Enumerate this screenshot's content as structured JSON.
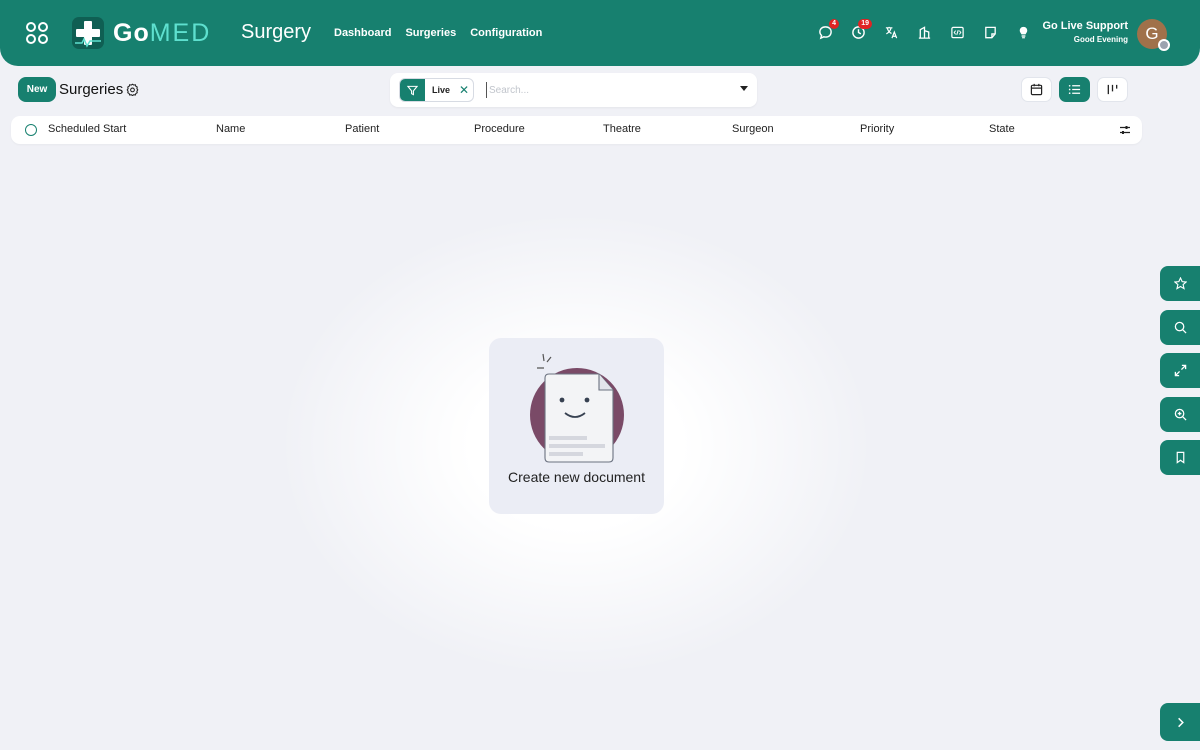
{
  "header": {
    "logo_prefix": "Go",
    "logo_suffix": "MED",
    "app_title": "Surgery",
    "nav": [
      "Dashboard",
      "Surgeries",
      "Configuration"
    ],
    "messages_badge": "4",
    "activities_badge": "19",
    "user_name": "Go Live Support",
    "greeting": "Good Evening",
    "avatar_letter": "G",
    "accent_color": "#17806f"
  },
  "control": {
    "new_label": "New",
    "breadcrumb": "Surgeries",
    "facet_label": "Live",
    "search_placeholder": "Search..."
  },
  "table": {
    "columns": [
      "Scheduled Start",
      "Name",
      "Patient",
      "Procedure",
      "Theatre",
      "Surgeon",
      "Priority",
      "State"
    ]
  },
  "empty": {
    "text": "Create new document"
  }
}
